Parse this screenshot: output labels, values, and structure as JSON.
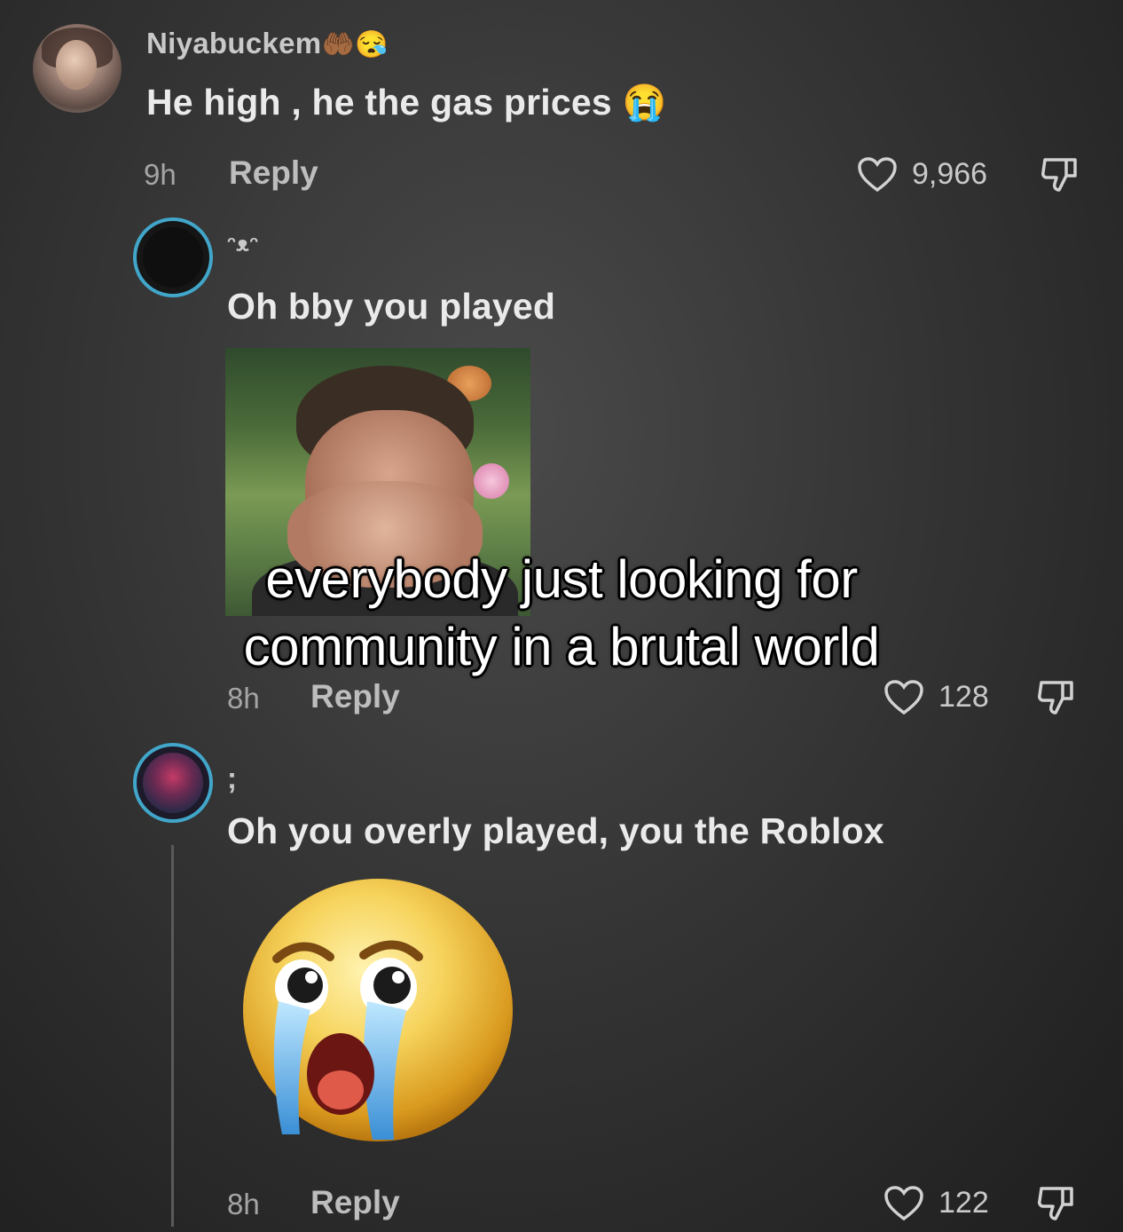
{
  "comments": [
    {
      "username": "Niyabuckem",
      "username_emojis": "🤲🏾😪",
      "text": "He high , he the gas prices",
      "text_emoji": "😭",
      "time": "9h",
      "reply_label": "Reply",
      "likes": "9,966"
    },
    {
      "username": "ᵔᴥᵔ",
      "text": "Oh bby you played",
      "time": "8h",
      "reply_label": "Reply",
      "likes": "128"
    },
    {
      "username": ";",
      "text": "Oh you overly played, you the Roblox",
      "time": "8h",
      "reply_label": "Reply",
      "likes": "122"
    }
  ],
  "overlay_caption": {
    "line1": "everybody just looking for",
    "line2": "community in a brutal world"
  },
  "colors": {
    "ring": "#41a6c9",
    "background": "#333333"
  }
}
